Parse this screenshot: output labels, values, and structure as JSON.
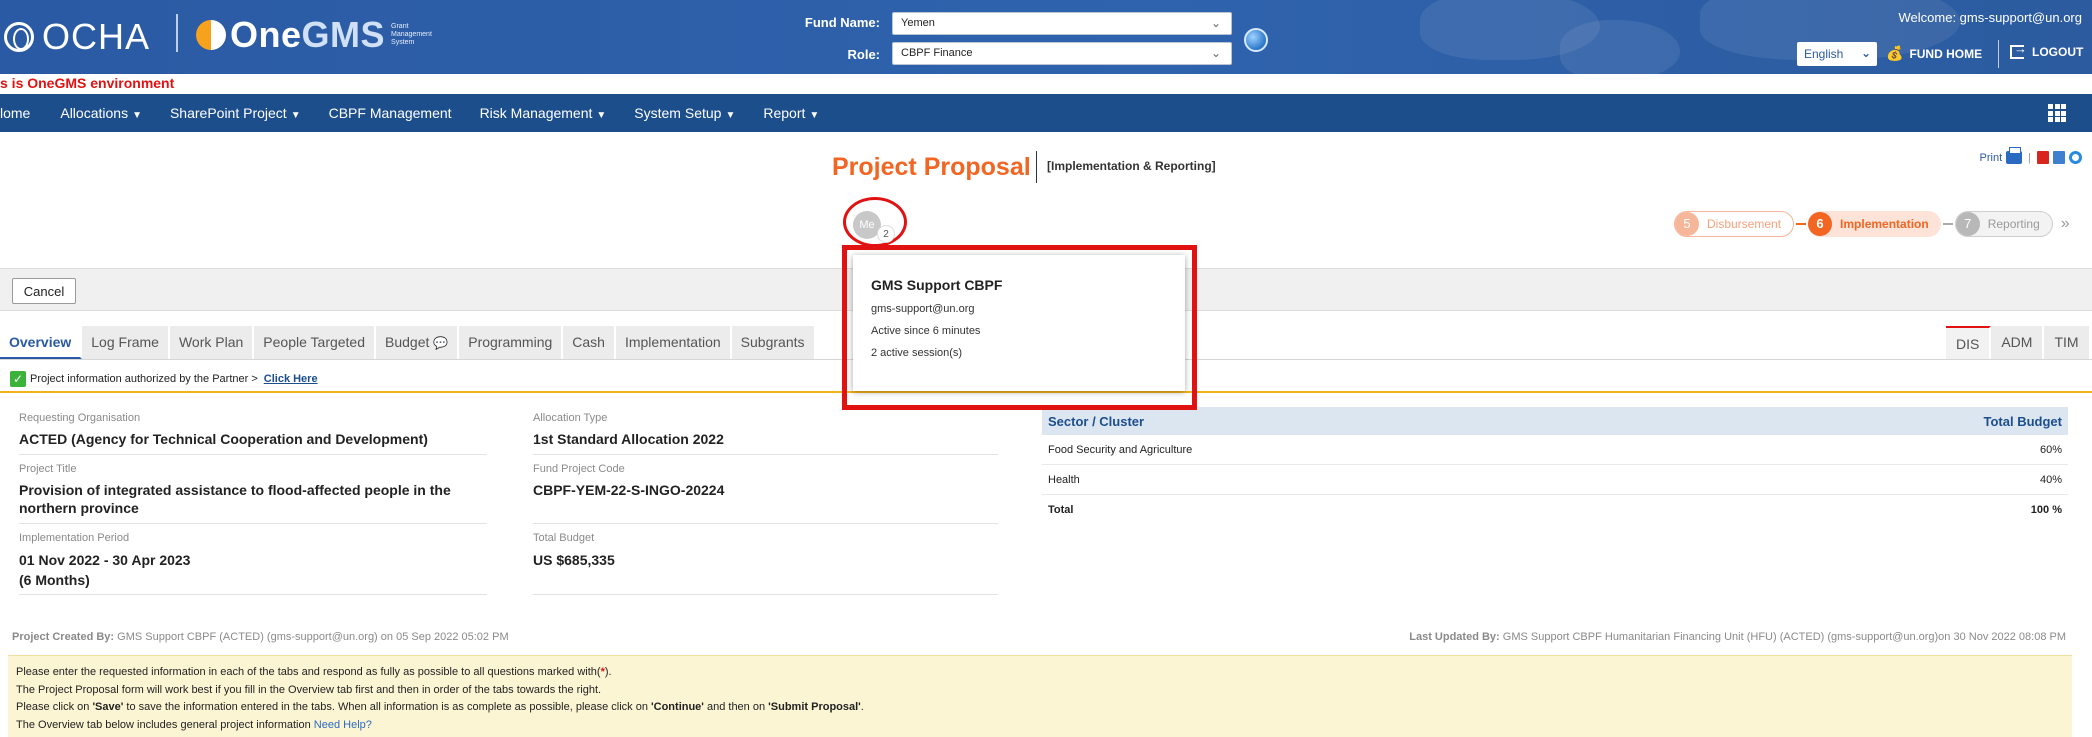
{
  "header": {
    "ocha_label": "OCHA",
    "onegms_prefix": "One",
    "onegms_suffix": "GMS",
    "gms_sub": [
      "Grant",
      "Management",
      "System"
    ],
    "fund_label": "Fund Name:",
    "fund_value": "Yemen",
    "role_label": "Role:",
    "role_value": "CBPF Finance",
    "welcome": "Welcome: gms-support@un.org",
    "language": "English",
    "fund_home": "FUND HOME",
    "logout": "LOGOUT"
  },
  "env_banner": "s is OneGMS environment",
  "nav": {
    "items": [
      {
        "label": "lome",
        "dropdown": false
      },
      {
        "label": "Allocations",
        "dropdown": true
      },
      {
        "label": "SharePoint Project",
        "dropdown": true
      },
      {
        "label": "CBPF Management",
        "dropdown": false
      },
      {
        "label": "Risk Management",
        "dropdown": true
      },
      {
        "label": "System Setup",
        "dropdown": true
      },
      {
        "label": "Report",
        "dropdown": true
      }
    ]
  },
  "title": {
    "main": "Project Proposal",
    "sub": "[Implementation & Reporting]",
    "print": "Print"
  },
  "avatar": {
    "initials": "Me",
    "badge": "2"
  },
  "popup": {
    "name": "GMS Support CBPF",
    "email": "gms-support@un.org",
    "active_since": "Active since 6 minutes",
    "sessions": "2 active session(s)"
  },
  "steps": [
    {
      "num": "5",
      "label": "Disbursement"
    },
    {
      "num": "6",
      "label": "Implementation"
    },
    {
      "num": "7",
      "label": "Reporting"
    }
  ],
  "cancel_label": "Cancel",
  "tabs": [
    "Overview",
    "Log Frame",
    "Work Plan",
    "People Targeted",
    "Budget",
    "Programming",
    "Cash",
    "Implementation",
    "Subgrants"
  ],
  "tabs_right": [
    "DIS",
    "ADM",
    "TIM"
  ],
  "auth": {
    "text": "Project information authorized by the Partner >",
    "link": "Click Here"
  },
  "overview": {
    "requesting_org_label": "Requesting Organisation",
    "requesting_org": "ACTED (Agency for Technical Cooperation and Development)",
    "allocation_type_label": "Allocation Type",
    "allocation_type": "1st Standard Allocation 2022",
    "project_title_label": "Project Title",
    "project_title": "Provision of integrated assistance to flood-affected people in the northern province",
    "fund_code_label": "Fund Project Code",
    "fund_code": "CBPF-YEM-22-S-INGO-20224",
    "period_label": "Implementation Period",
    "period": "01 Nov 2022 - 30 Apr 2023",
    "period_months": "(6 Months)",
    "total_budget_label": "Total Budget",
    "total_budget": "US $685,335"
  },
  "sector": {
    "head_left": "Sector / Cluster",
    "head_right": "Total Budget",
    "rows": [
      {
        "name": "Food Security and Agriculture",
        "value": "60%"
      },
      {
        "name": "Health",
        "value": "40%"
      }
    ],
    "total_label": "Total",
    "total_value": "100 %"
  },
  "footer": {
    "created_label": "Project Created By:",
    "created_text": "GMS Support CBPF (ACTED) (gms-support@un.org) on 05 Sep 2022 05:02 PM",
    "updated_label": "Last Updated By:",
    "updated_text": "GMS Support CBPF Humanitarian Financing Unit (HFU) (ACTED) (gms-support@un.org)on 30 Nov 2022 08:08 PM"
  },
  "info": {
    "line1_pre": "Please enter the requested information in each of the tabs and respond as fully as possible to all questions marked with(",
    "line1_mark": "*",
    "line1_post": ").",
    "line2": "The Project Proposal form will work best if you fill in the Overview tab first and then in order of the tabs towards the right.",
    "line3_a": "Please click on ",
    "line3_b": "'Save'",
    "line3_c": " to save the information entered in the tabs. When all information is as complete as possible, please click on ",
    "line3_d": "'Continue'",
    "line3_e": " and then on ",
    "line3_f": "'Submit Proposal'",
    "line3_g": ".",
    "line4": "The Overview tab below includes general project information",
    "help": "Need Help?"
  }
}
